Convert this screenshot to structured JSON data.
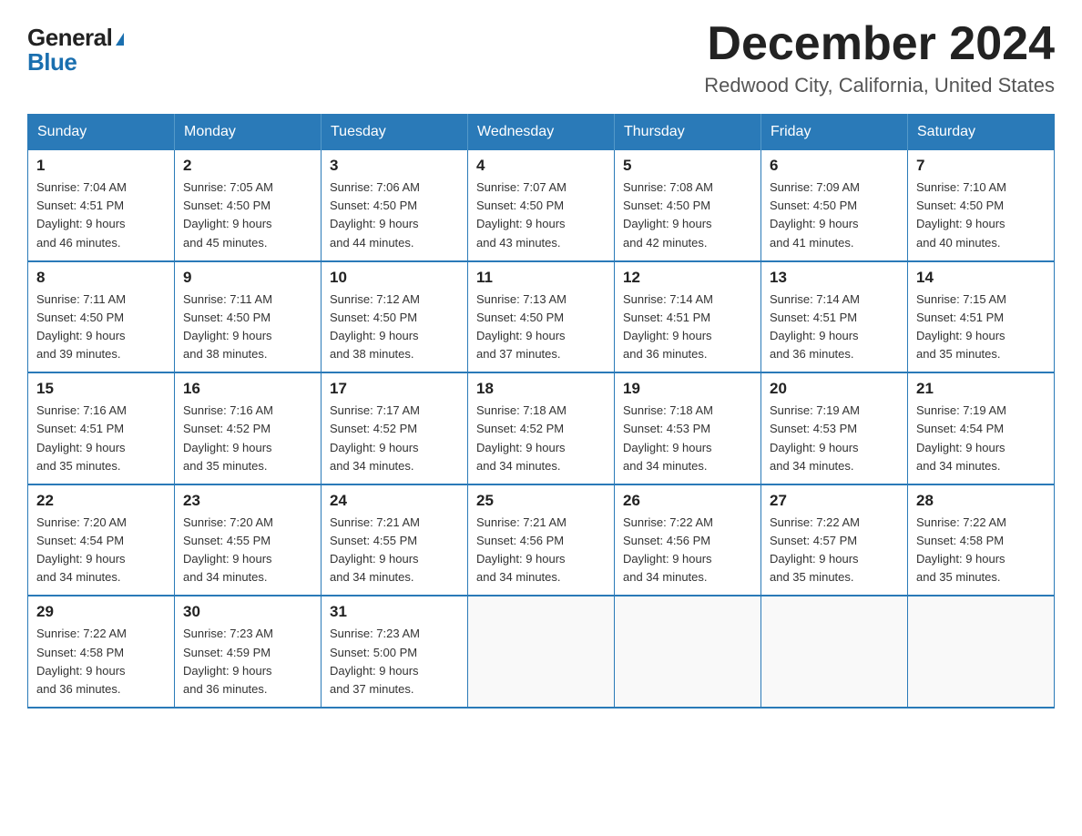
{
  "logo": {
    "general": "General",
    "blue": "Blue"
  },
  "title": {
    "month": "December 2024",
    "location": "Redwood City, California, United States"
  },
  "headers": [
    "Sunday",
    "Monday",
    "Tuesday",
    "Wednesday",
    "Thursday",
    "Friday",
    "Saturday"
  ],
  "weeks": [
    [
      {
        "day": "1",
        "info": "Sunrise: 7:04 AM\nSunset: 4:51 PM\nDaylight: 9 hours\nand 46 minutes."
      },
      {
        "day": "2",
        "info": "Sunrise: 7:05 AM\nSunset: 4:50 PM\nDaylight: 9 hours\nand 45 minutes."
      },
      {
        "day": "3",
        "info": "Sunrise: 7:06 AM\nSunset: 4:50 PM\nDaylight: 9 hours\nand 44 minutes."
      },
      {
        "day": "4",
        "info": "Sunrise: 7:07 AM\nSunset: 4:50 PM\nDaylight: 9 hours\nand 43 minutes."
      },
      {
        "day": "5",
        "info": "Sunrise: 7:08 AM\nSunset: 4:50 PM\nDaylight: 9 hours\nand 42 minutes."
      },
      {
        "day": "6",
        "info": "Sunrise: 7:09 AM\nSunset: 4:50 PM\nDaylight: 9 hours\nand 41 minutes."
      },
      {
        "day": "7",
        "info": "Sunrise: 7:10 AM\nSunset: 4:50 PM\nDaylight: 9 hours\nand 40 minutes."
      }
    ],
    [
      {
        "day": "8",
        "info": "Sunrise: 7:11 AM\nSunset: 4:50 PM\nDaylight: 9 hours\nand 39 minutes."
      },
      {
        "day": "9",
        "info": "Sunrise: 7:11 AM\nSunset: 4:50 PM\nDaylight: 9 hours\nand 38 minutes."
      },
      {
        "day": "10",
        "info": "Sunrise: 7:12 AM\nSunset: 4:50 PM\nDaylight: 9 hours\nand 38 minutes."
      },
      {
        "day": "11",
        "info": "Sunrise: 7:13 AM\nSunset: 4:50 PM\nDaylight: 9 hours\nand 37 minutes."
      },
      {
        "day": "12",
        "info": "Sunrise: 7:14 AM\nSunset: 4:51 PM\nDaylight: 9 hours\nand 36 minutes."
      },
      {
        "day": "13",
        "info": "Sunrise: 7:14 AM\nSunset: 4:51 PM\nDaylight: 9 hours\nand 36 minutes."
      },
      {
        "day": "14",
        "info": "Sunrise: 7:15 AM\nSunset: 4:51 PM\nDaylight: 9 hours\nand 35 minutes."
      }
    ],
    [
      {
        "day": "15",
        "info": "Sunrise: 7:16 AM\nSunset: 4:51 PM\nDaylight: 9 hours\nand 35 minutes."
      },
      {
        "day": "16",
        "info": "Sunrise: 7:16 AM\nSunset: 4:52 PM\nDaylight: 9 hours\nand 35 minutes."
      },
      {
        "day": "17",
        "info": "Sunrise: 7:17 AM\nSunset: 4:52 PM\nDaylight: 9 hours\nand 34 minutes."
      },
      {
        "day": "18",
        "info": "Sunrise: 7:18 AM\nSunset: 4:52 PM\nDaylight: 9 hours\nand 34 minutes."
      },
      {
        "day": "19",
        "info": "Sunrise: 7:18 AM\nSunset: 4:53 PM\nDaylight: 9 hours\nand 34 minutes."
      },
      {
        "day": "20",
        "info": "Sunrise: 7:19 AM\nSunset: 4:53 PM\nDaylight: 9 hours\nand 34 minutes."
      },
      {
        "day": "21",
        "info": "Sunrise: 7:19 AM\nSunset: 4:54 PM\nDaylight: 9 hours\nand 34 minutes."
      }
    ],
    [
      {
        "day": "22",
        "info": "Sunrise: 7:20 AM\nSunset: 4:54 PM\nDaylight: 9 hours\nand 34 minutes."
      },
      {
        "day": "23",
        "info": "Sunrise: 7:20 AM\nSunset: 4:55 PM\nDaylight: 9 hours\nand 34 minutes."
      },
      {
        "day": "24",
        "info": "Sunrise: 7:21 AM\nSunset: 4:55 PM\nDaylight: 9 hours\nand 34 minutes."
      },
      {
        "day": "25",
        "info": "Sunrise: 7:21 AM\nSunset: 4:56 PM\nDaylight: 9 hours\nand 34 minutes."
      },
      {
        "day": "26",
        "info": "Sunrise: 7:22 AM\nSunset: 4:56 PM\nDaylight: 9 hours\nand 34 minutes."
      },
      {
        "day": "27",
        "info": "Sunrise: 7:22 AM\nSunset: 4:57 PM\nDaylight: 9 hours\nand 35 minutes."
      },
      {
        "day": "28",
        "info": "Sunrise: 7:22 AM\nSunset: 4:58 PM\nDaylight: 9 hours\nand 35 minutes."
      }
    ],
    [
      {
        "day": "29",
        "info": "Sunrise: 7:22 AM\nSunset: 4:58 PM\nDaylight: 9 hours\nand 36 minutes."
      },
      {
        "day": "30",
        "info": "Sunrise: 7:23 AM\nSunset: 4:59 PM\nDaylight: 9 hours\nand 36 minutes."
      },
      {
        "day": "31",
        "info": "Sunrise: 7:23 AM\nSunset: 5:00 PM\nDaylight: 9 hours\nand 37 minutes."
      },
      {
        "day": "",
        "info": ""
      },
      {
        "day": "",
        "info": ""
      },
      {
        "day": "",
        "info": ""
      },
      {
        "day": "",
        "info": ""
      }
    ]
  ]
}
